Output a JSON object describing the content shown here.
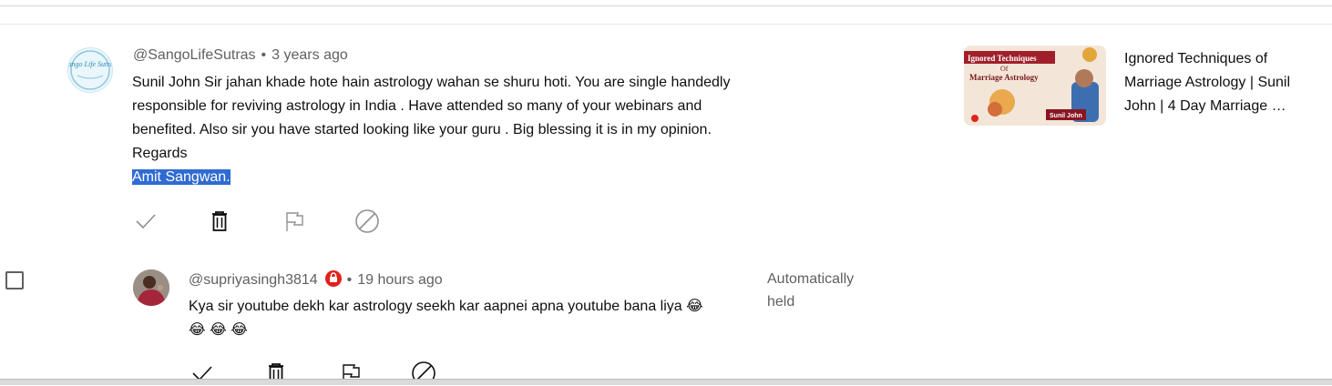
{
  "comments": [
    {
      "handle": "@SangoLifeSutras",
      "separator": "•",
      "time": "3 years ago",
      "avatar_text": "Sango Life Sutras",
      "lines": [
        "Sunil John Sir jahan khade hote hain astrology wahan se shuru hoti. You are single handedly",
        "responsible for reviving astrology in India . Have attended so many of your webinars and",
        "benefited. Also sir you have started looking like your guru . Big blessing it is in my opinion.",
        "Regards"
      ],
      "selected_line": "Amit Sangwan.",
      "actions": [
        "approve-icon",
        "delete-icon",
        "flag-icon",
        "block-icon"
      ]
    },
    {
      "handle": "@supriyasingh3814",
      "separator": "•",
      "time": "19 hours ago",
      "lines": [
        "Kya sir youtube dekh kar astrology seekh kar aapnei apna youtube bana liya 😂",
        "😂 😂 😂"
      ],
      "status": "Automatically held",
      "actions": [
        "approve-icon",
        "delete-icon",
        "flag-icon",
        "block-icon"
      ]
    }
  ],
  "video": {
    "title": "Ignored Techniques of Marriage Astrology | Sunil John | 4 Day Marriage …",
    "thumb_heading": "Ignored Techniques",
    "thumb_of": "Of",
    "thumb_sub": "Marriage Astrology",
    "thumb_name": "Sunil John"
  },
  "colors": {
    "text": "#0f0f0f",
    "secondary": "#606060",
    "selection": "#2f6bd1",
    "badge": "#e0221b"
  }
}
